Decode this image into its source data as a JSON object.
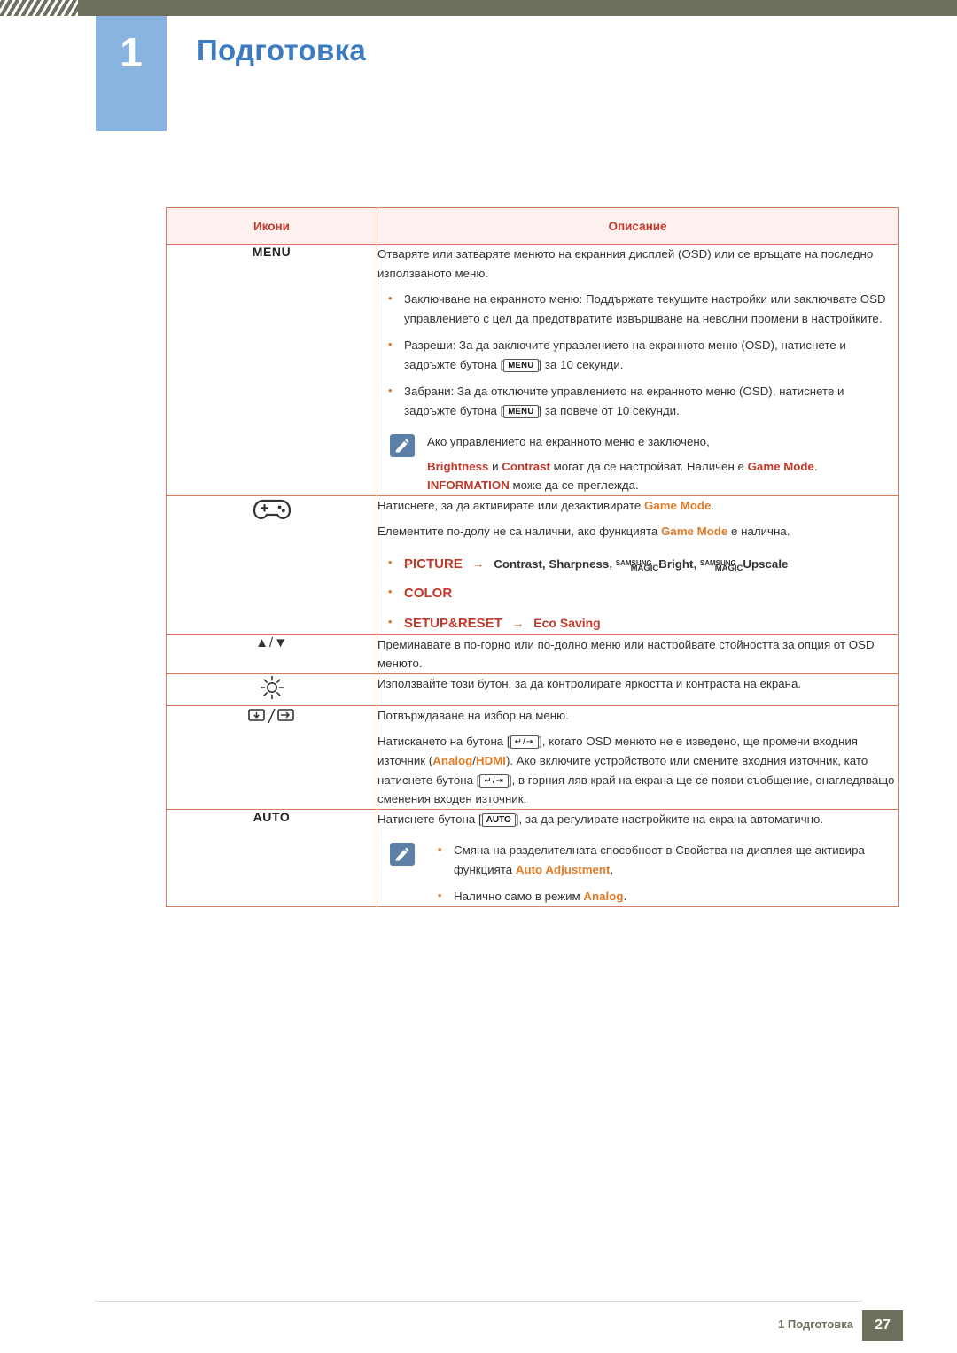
{
  "header": {
    "chapter_number": "1",
    "chapter_title": "Подготовка"
  },
  "table": {
    "headers": {
      "icons": "Икони",
      "description": "Описание"
    },
    "rows": [
      {
        "icon_label": "MENU",
        "icon_type": "text",
        "lines": {
          "intro": "Отваряте или затваряте менюто на екранния дисплей (OSD) или се връщате на последно използваното меню.",
          "b1": "Заключване на екранното меню: Поддържате текущите настройки или заключвате OSD управлението с цел да предотвратите извършване на неволни промени в настройките.",
          "b2a": "Разреши: За да заключите управлението на екранното меню (OSD), натиснете и задръжте бутона [",
          "b2key": "MENU",
          "b2b": "] за 10 секунди.",
          "b3a": "Забрани: За да отключите управлението на екранното меню (OSD), натиснете и задръжте бутона [",
          "b3key": "MENU",
          "b3b": "] за повече от 10 секунди.",
          "note1": "Ако управлението на екранното меню е заключено,",
          "note2_a": "Brightness",
          "note2_b": " и ",
          "note2_c": "Contrast",
          "note2_d": " могат да се настройват. Наличен е ",
          "note2_e": "Game Mode",
          "note2_f": ". ",
          "note2_g": "INFORMATION",
          "note2_h": " може да се преглежда."
        }
      },
      {
        "icon_label": "gamepad-icon",
        "icon_type": "gamepad",
        "lines": {
          "p1_a": "Натиснете, за да активирате или дезактивирате ",
          "p1_b": "Game Mode",
          "p1_c": ".",
          "p2_a": "Елементите по-долу не са налични, ако функцията ",
          "p2_b": "Game Mode",
          "p2_c": " е налична.",
          "b1_picture": "PICTURE",
          "b1_arrow": "→",
          "b1_contrast": "Contrast",
          "b1_sharpness": "Sharpness",
          "b1_magic_sup": "SAMSUNG",
          "b1_magic_word": "MAGIC",
          "b1_bright": "Bright",
          "b1_upscale": "Upscale",
          "b2_color": "COLOR",
          "b3_setup": "SETUP&RESET",
          "b3_arrow": "→",
          "b3_eco": "Eco Saving"
        }
      },
      {
        "icon_label": "▲/▼",
        "icon_type": "updown",
        "lines": {
          "p1": "Преминавате в по-горно или по-долно меню или настройвате стойността за опция от OSD менюто."
        }
      },
      {
        "icon_label": "brightness-icon",
        "icon_type": "brightness",
        "lines": {
          "p1": "Използвайте този бутон, за да контролирате яркостта и контраста на екрана."
        }
      },
      {
        "icon_label": "enter-source-icon",
        "icon_type": "enter-source",
        "lines": {
          "p1": "Потвърждаване на избор на меню.",
          "p2_a": "Натискането на бутона [",
          "p2_key": "↵/⇥",
          "p2_b": "], когато OSD менюто не е изведено, ще промени входния източник (",
          "p2_c": "Analog",
          "p2_slash": "/",
          "p2_d": "HDMI",
          "p2_e": "). Ако включите устройството или смените входния източник, като натиснете бутона [",
          "p2_key2": "↵/⇥",
          "p2_f": "], в горния ляв край на екрана ще се появи съобщение, онагледяващо сменения входен източник."
        }
      },
      {
        "icon_label": "AUTO",
        "icon_type": "text",
        "lines": {
          "p1_a": "Натиснете бутона [",
          "p1_key": "AUTO",
          "p1_b": "], за да регулирате настройките на екрана автоматично.",
          "note_b1_a": "Смяна на разделителната способност в Свойства на дисплея ще активира функцията ",
          "note_b1_b": "Auto Adjustment",
          "note_b1_c": ".",
          "note_b2_a": "Налично само в режим ",
          "note_b2_b": "Analog",
          "note_b2_c": "."
        }
      }
    ]
  },
  "footer": {
    "text": "1 Подготовка",
    "page": "27"
  },
  "colors": {
    "chapter_blue": "#3c7bbf",
    "badge_blue": "#8ab4e0",
    "table_border": "#d97b5a",
    "header_bg": "#fdf1ef",
    "header_text": "#c0392b",
    "accent_orange": "#d9772f",
    "footer_olive": "#6f6f5e"
  }
}
